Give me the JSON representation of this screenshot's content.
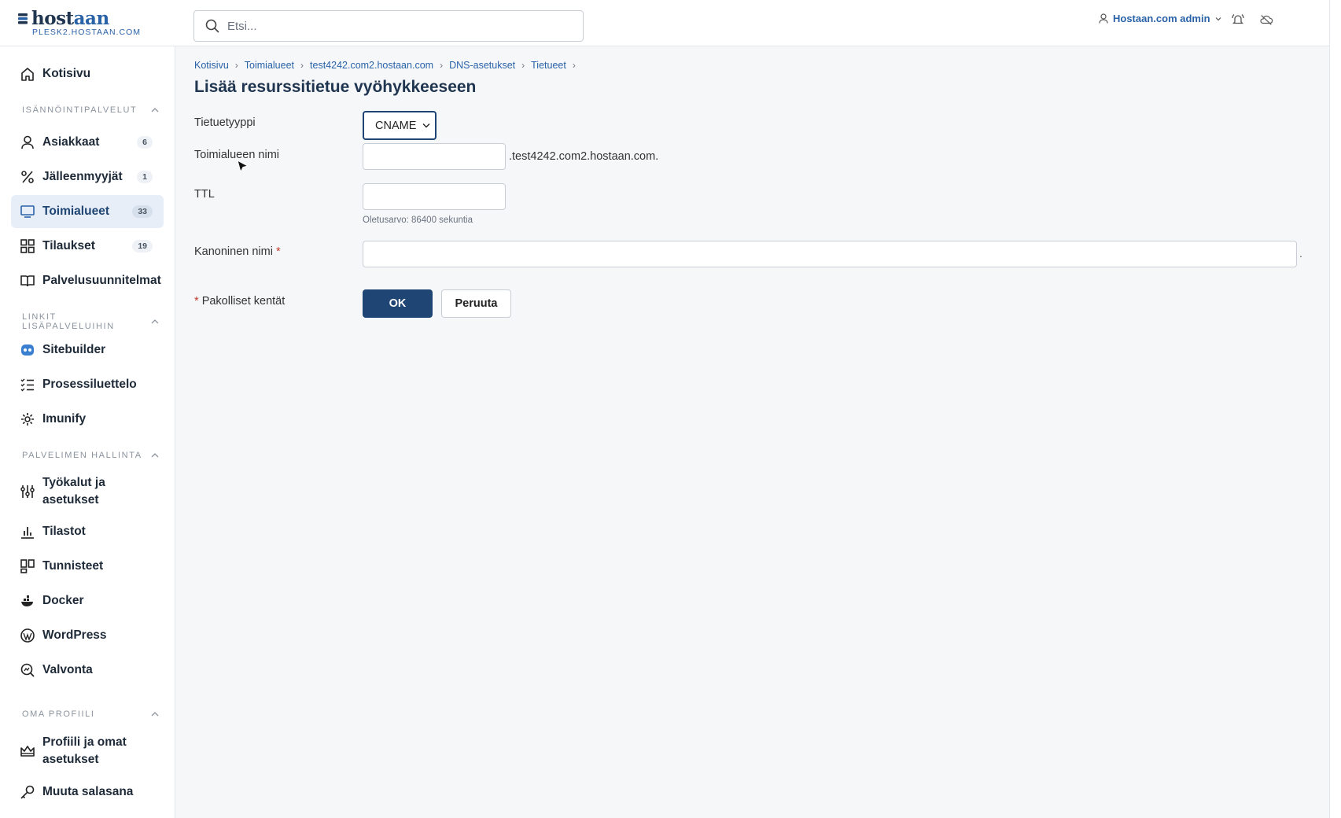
{
  "brand": {
    "name_part1": "host",
    "name_part2": "aan",
    "subdomain": "PLESK2.HOSTAAN.COM"
  },
  "search": {
    "placeholder": "Etsi..."
  },
  "user": {
    "name": "Hostaan.com admin",
    "icons": [
      "user-icon",
      "chevron-down-icon",
      "bell-icon",
      "cloud-icon"
    ]
  },
  "sidebar": {
    "home": "Kotisivu",
    "sections": {
      "hosting": "ISÄNNÖINTIPALVELUT",
      "links": "LINKIT LISÄPALVELUIHIN",
      "server": "PALVELIMEN HALLINTA",
      "profile": "OMA PROFIILI"
    },
    "items": {
      "customers": {
        "label": "Asiakkaat",
        "count": "6"
      },
      "resellers": {
        "label": "Jälleenmyyjät",
        "count": "1"
      },
      "domains": {
        "label": "Toimialueet",
        "count": "33"
      },
      "subscriptions": {
        "label": "Tilaukset",
        "count": "19"
      },
      "plans": {
        "label": "Palvelusuunnitelmat"
      },
      "sitebuilder": {
        "label": "Sitebuilder"
      },
      "processes": {
        "label": "Prosessiluettelo"
      },
      "imunify": {
        "label": "Imunify"
      },
      "tools_1": "Työkalut ja",
      "tools_2": "asetukset",
      "stats": {
        "label": "Tilastot"
      },
      "ids": {
        "label": "Tunnisteet"
      },
      "docker": {
        "label": "Docker"
      },
      "wordpress": {
        "label": "WordPress"
      },
      "monitoring": {
        "label": "Valvonta"
      },
      "profile_1": "Profiili ja omat",
      "profile_2": "asetukset",
      "password": {
        "label": "Muuta salasana"
      }
    },
    "active_item": "Toimialueet"
  },
  "breadcrumb": [
    "Kotisivu",
    "Toimialueet",
    "test4242.com2.hostaan.com",
    "DNS-asetukset",
    "Tietueet"
  ],
  "page": {
    "title": "Lisää resurssitietue vyöhykkeeseen"
  },
  "form": {
    "record_type": {
      "label": "Tietuetyyppi",
      "value": "CNAME"
    },
    "domain_name": {
      "label": "Toimialueen nimi",
      "value": "",
      "suffix": ".test4242.com2.hostaan.com."
    },
    "ttl": {
      "label": "TTL",
      "value": "",
      "hint": "Oletusarvo: 86400 sekuntia"
    },
    "canonical_name": {
      "label": "Kanoninen nimi",
      "value": "",
      "suffix": "."
    },
    "required_note": "Pakolliset kentät",
    "required_marker": "*",
    "ok_label": "OK",
    "cancel_label": "Peruuta"
  }
}
